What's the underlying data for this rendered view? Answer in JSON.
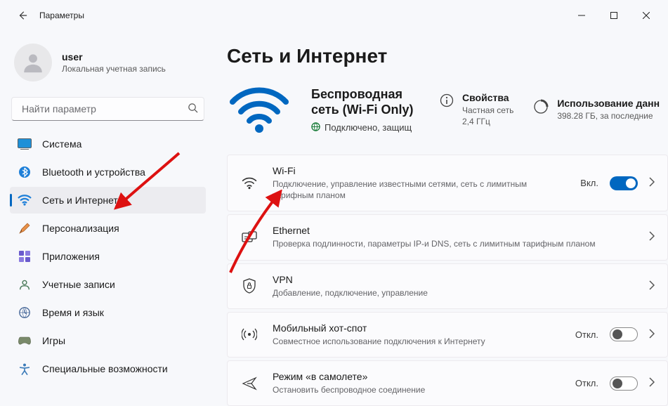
{
  "titlebar": {
    "title": "Параметры"
  },
  "user": {
    "name": "user",
    "subtitle": "Локальная учетная запись"
  },
  "search": {
    "placeholder": "Найти параметр"
  },
  "nav": {
    "items": [
      {
        "label": "Система"
      },
      {
        "label": "Bluetooth и устройства"
      },
      {
        "label": "Сеть и Интернет"
      },
      {
        "label": "Персонализация"
      },
      {
        "label": "Приложения"
      },
      {
        "label": "Учетные записи"
      },
      {
        "label": "Время и язык"
      },
      {
        "label": "Игры"
      },
      {
        "label": "Специальные возможности"
      }
    ]
  },
  "page": {
    "heading": "Сеть и Интернет",
    "network": {
      "title_l1": "Беспроводная",
      "title_l2": "сеть (Wi-Fi Only)",
      "status": "Подключено, защищ"
    },
    "props": {
      "title": "Свойства",
      "sub": "Частная сеть\n2,4 ГГц"
    },
    "usage": {
      "title": "Использование данн",
      "sub": "398.28 ГБ, за последние"
    }
  },
  "cards": {
    "wifi": {
      "title": "Wi-Fi",
      "sub": "Подключение, управление известными сетями, сеть с лимитным тарифным планом",
      "state": "Вкл."
    },
    "ethernet": {
      "title": "Ethernet",
      "sub": "Проверка подлинности, параметры IP-и DNS, сеть с лимитным тарифным планом"
    },
    "vpn": {
      "title": "VPN",
      "sub": "Добавление, подключение, управление"
    },
    "hotspot": {
      "title": "Мобильный хот-спот",
      "sub": "Совместное использование подключения к Интернету",
      "state": "Откл."
    },
    "airplane": {
      "title": "Режим «в самолете»",
      "sub": "Остановить беспроводное соединение",
      "state": "Откл."
    }
  }
}
